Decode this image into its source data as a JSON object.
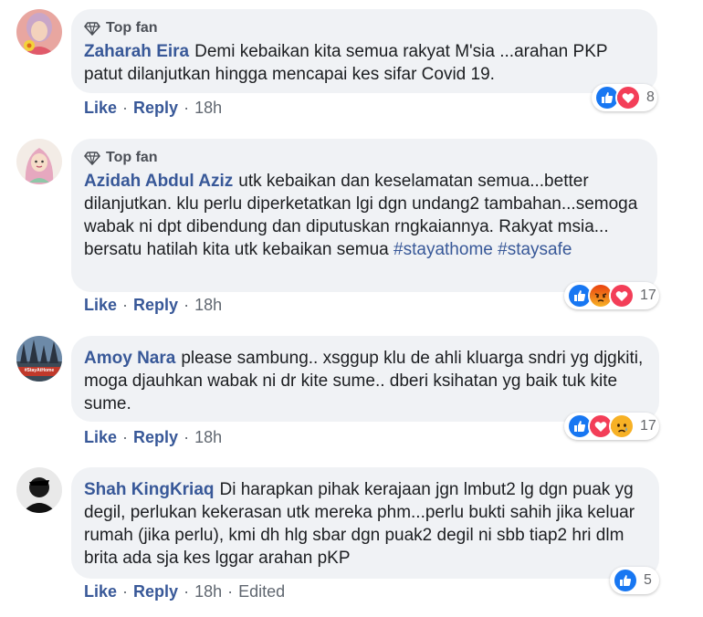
{
  "comments": [
    {
      "avatar_icon": "flower-avatar-icon",
      "badge": "Top fan",
      "author": "Zaharah Eira",
      "text": "Demi kebaikan kita semua rakyat M'sia ...arahan PKP patut dilanjutkan hingga mencapai kes sifar Covid 19.",
      "tags": [],
      "like_label": "Like",
      "reply_label": "Reply",
      "time": "18h",
      "reactions": [
        "like-icon",
        "love-icon"
      ],
      "reaction_count": "8"
    },
    {
      "avatar_icon": "hijab-avatar-icon",
      "badge": "Top fan",
      "author": "Azidah Abdul Aziz",
      "text": "utk kebaikan dan keselamatan semua...better dilanjutkan. klu perlu diperketatkan lgi dgn undang2 tambahan...semoga wabak ni dpt dibendung dan diputuskan rngkaiannya. Rakyat msia... bersatu hatilah kita utk kebaikan semua",
      "tags": [
        "#stayathome",
        "#staysafe"
      ],
      "like_label": "Like",
      "reply_label": "Reply",
      "time": "18h",
      "reactions": [
        "like-icon",
        "angry-icon",
        "love-icon"
      ],
      "reaction_count": "17"
    },
    {
      "avatar_icon": "forest-avatar-icon",
      "avatar_text": "#StayAtHome",
      "author": "Amoy Nara",
      "text": "please sambung.. xsggup klu de ahli kluarga sndri yg djgkiti, moga djauhkan wabak ni dr kite sume.. dberi ksihatan yg baik tuk kite sume.",
      "tags": [],
      "like_label": "Like",
      "reply_label": "Reply",
      "time": "18h",
      "reactions": [
        "like-icon",
        "love-icon",
        "sad-icon"
      ],
      "reaction_count": "17"
    },
    {
      "avatar_icon": "person-avatar-icon",
      "author": "Shah KingKriaq",
      "text": "Di harapkan pihak kerajaan jgn lmbut2 lg dgn puak yg degil, perlukan kekerasan utk mereka phm...perlu bukti sahih jika keluar rumah (jika perlu), kmi dh hlg sbar dgn puak2 degil ni sbb tiap2 hri dlm brita ada sja kes lggar arahan pKP",
      "tags": [],
      "like_label": "Like",
      "reply_label": "Reply",
      "time": "18h",
      "edited": "Edited",
      "reactions": [
        "like-icon"
      ],
      "reaction_count": "5"
    }
  ],
  "colors": {
    "link": "#385898",
    "bubble": "#f0f2f5",
    "like": "#1877f2",
    "love": "#f33e58",
    "angry": "#e9710f",
    "sad": "#f7b125"
  },
  "separator": "·"
}
